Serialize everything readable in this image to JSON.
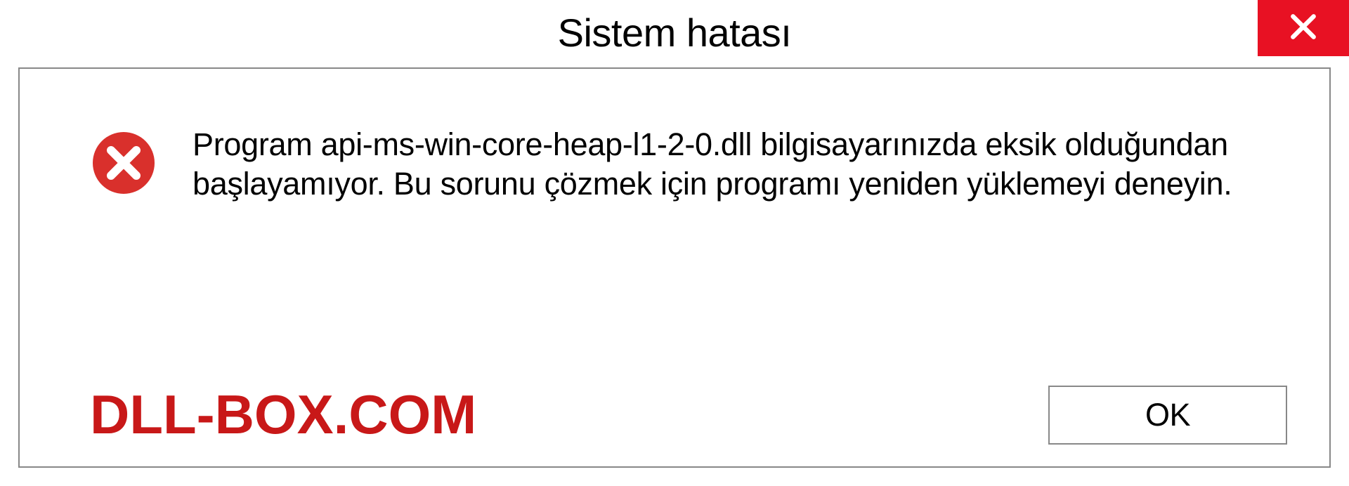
{
  "titlebar": {
    "title": "Sistem hatası"
  },
  "dialog": {
    "message": "Program api-ms-win-core-heap-l1-2-0.dll bilgisayarınızda eksik olduğundan başlayamıyor. Bu sorunu çözmek için programı yeniden yüklemeyi deneyin."
  },
  "buttons": {
    "ok": "OK"
  },
  "watermark": "DLL-BOX.COM",
  "colors": {
    "close_bg": "#e81123",
    "error_icon": "#d9302c",
    "watermark": "#c81818",
    "border": "#888888"
  }
}
